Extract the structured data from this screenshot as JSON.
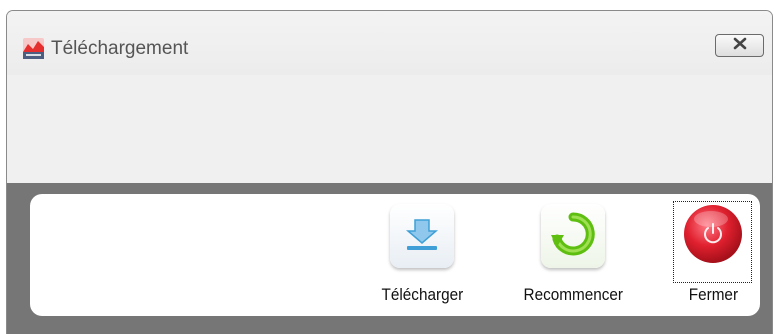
{
  "window": {
    "title": "Téléchargement",
    "close_icon": "close-x-icon",
    "app_icon": "app-logo-icon"
  },
  "toolbar": {
    "actions": [
      {
        "label": "Télécharger",
        "icon": "download-icon",
        "color": "#3f9fd6"
      },
      {
        "label": "Recommencer",
        "icon": "refresh-icon",
        "color": "#5fbf10"
      },
      {
        "label": "Fermer",
        "icon": "power-icon",
        "color": "#e0202f"
      }
    ]
  },
  "colors": {
    "background": "#f0f0f0",
    "band": "#767676",
    "panel": "#ffffff"
  }
}
